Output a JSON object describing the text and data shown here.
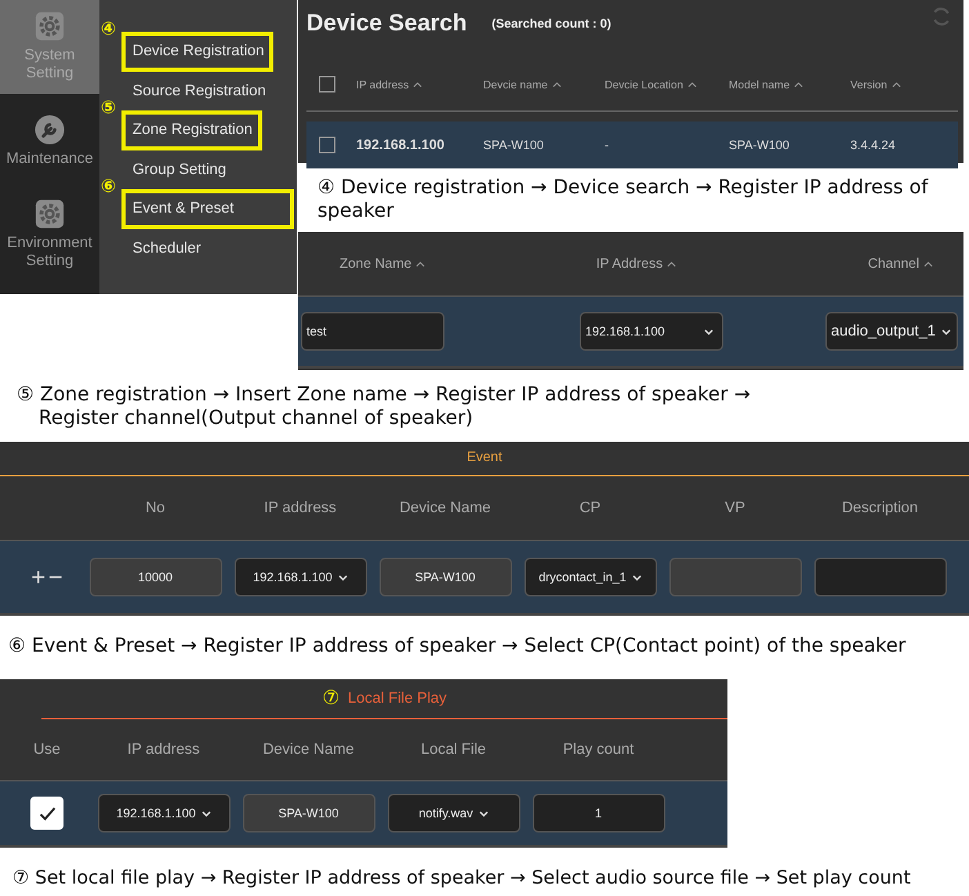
{
  "menu": {
    "categories": [
      {
        "label": "System Setting",
        "kind": "gear",
        "selected": true
      },
      {
        "label": "Maintenance",
        "kind": "wrench",
        "selected": false
      },
      {
        "label": "Environment Setting",
        "kind": "gear",
        "selected": false
      }
    ],
    "items": [
      {
        "label": "Device Registration",
        "marker": "④",
        "highlighted": true
      },
      {
        "label": "Source Registration",
        "highlighted": false
      },
      {
        "label": "Zone Registration",
        "marker": "⑤",
        "highlighted": true
      },
      {
        "label": "Group Setting",
        "highlighted": false
      },
      {
        "label": "Event & Preset",
        "marker": "⑥",
        "highlighted": true
      },
      {
        "label": "Scheduler",
        "highlighted": false
      }
    ]
  },
  "device_search": {
    "title": "Device Search",
    "count": "(Searched count : 0)",
    "header_checked": false,
    "columns": [
      "IP address",
      "Devcie name",
      "Devcie Location",
      "Model name",
      "Version"
    ],
    "rows": [
      {
        "checked": false,
        "cells": [
          "192.168.1.100",
          "SPA-W100",
          "-",
          "SPA-W100",
          "3.4.4.24"
        ]
      }
    ],
    "caption": "④ Device registration → Device search → Register IP address of speaker"
  },
  "zone": {
    "columns": [
      "Zone Name",
      "IP Address",
      "Channel"
    ],
    "fields": [
      {
        "kind": "input",
        "value": "test"
      },
      {
        "kind": "select",
        "value": "192.168.1.100"
      },
      {
        "kind": "select",
        "value": "audio_output_1"
      }
    ],
    "caption_lines": [
      "⑤ Zone registration → Insert Zone name → Register IP address of speaker →",
      "Register channel(Output channel of speaker)"
    ]
  },
  "event": {
    "title": "Event",
    "columns": [
      "No",
      "IP address",
      "Device Name",
      "CP",
      "VP",
      "Description"
    ],
    "add": "+",
    "remove": "−",
    "fields": [
      {
        "kind": "text",
        "value": "10000"
      },
      {
        "kind": "select",
        "value": "192.168.1.100"
      },
      {
        "kind": "text",
        "value": "SPA-W100"
      },
      {
        "kind": "select",
        "value": "drycontact_in_1"
      },
      {
        "kind": "text"
      },
      {
        "kind": "input"
      }
    ],
    "caption": "⑥ Event & Preset → Register IP address of speaker → Select CP(Contact point) of the speaker"
  },
  "local_file": {
    "marker": "⑦",
    "title": "Local File Play",
    "columns": [
      "Use",
      "IP address",
      "Device Name",
      "Local File",
      "Play count"
    ],
    "use_checked": true,
    "fields": [
      {
        "kind": "select",
        "value": "192.168.1.100"
      },
      {
        "kind": "text",
        "value": "SPA-W100"
      },
      {
        "kind": "select",
        "value": "notify.wav"
      },
      {
        "kind": "input",
        "value": "1"
      }
    ],
    "caption": "⑦ Set local file play → Register IP address of speaker → Select audio source file → Set play count"
  }
}
